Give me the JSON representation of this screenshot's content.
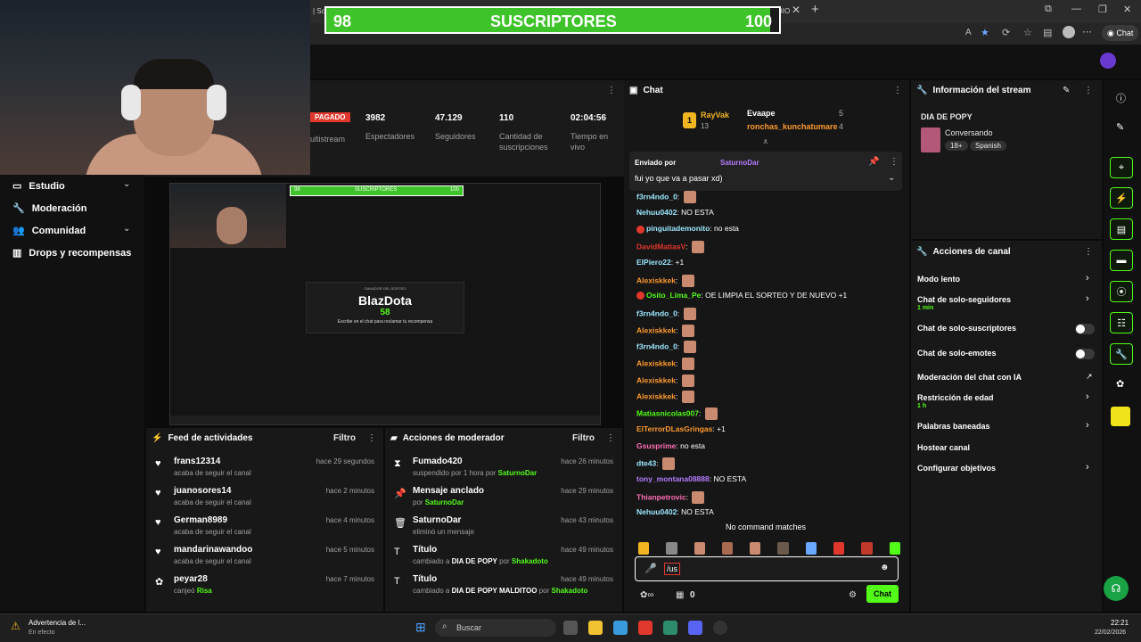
{
  "browser": {
    "tab_fragment": "| Sor",
    "tab_fragment2": "DIO",
    "new_tab": "+",
    "chat_button": "Chat"
  },
  "sub_goal": {
    "current": "98",
    "label": "SUSCRIPTORES",
    "target": "100",
    "progress": 0.98
  },
  "stats": {
    "live_badge": "PAGADO",
    "multistream": "ultistream",
    "viewers": {
      "value": "3982",
      "label": "Espectadores"
    },
    "followers": {
      "value": "47.129",
      "label": "Seguidores"
    },
    "subs": {
      "value": "110",
      "label": "Cantidad de suscripciones"
    },
    "time": {
      "value": "02:04:56",
      "label": "Tiempo en vivo"
    }
  },
  "nav": [
    {
      "label": "Estudio",
      "chevron": "⌄"
    },
    {
      "label": "Moderación"
    },
    {
      "label": "Comunidad",
      "chevron": "⌄"
    },
    {
      "label": "Drops y recompensas"
    }
  ],
  "player": {
    "sub_label": "SUSCRIPTORES",
    "sub_current": "98",
    "sub_target": "100",
    "card_small": "GANADOR DEL SORTEO",
    "winner": "BlazDota",
    "timer": "58",
    "instruction": "Escribe en el chat para reclamar tu recompensa"
  },
  "activity_feed": {
    "title": "Feed de actividades",
    "filter": "Filtro",
    "items": [
      {
        "name": "frans12314",
        "sub": "acaba de seguir el canal",
        "time": "hace 29 segundos"
      },
      {
        "name": "juanosores14",
        "sub": "acaba de seguir el canal",
        "time": "hace 2 minutos"
      },
      {
        "name": "German8989",
        "sub": "acaba de seguir el canal",
        "time": "hace 4 minutos"
      },
      {
        "name": "mandarinawandoo",
        "sub": "acaba de seguir el canal",
        "time": "hace 5 minutos"
      },
      {
        "name": "peyar28",
        "sub": "canjeó",
        "sub_hl": "Risa",
        "time": "hace 7 minutos"
      }
    ]
  },
  "mod_actions": {
    "title": "Acciones de moderador",
    "filter": "Filtro",
    "items": [
      {
        "name": "Fumado420",
        "sub": "suspendido por 1 hora por",
        "sub_hl": "SaturnoDar",
        "time": "hace 26 minutos"
      },
      {
        "name": "Mensaje anclado",
        "sub": "por",
        "sub_hl": "SaturnoDar",
        "time": "hace 29 minutos"
      },
      {
        "name": "SaturnoDar",
        "sub": "eliminó un mensaje",
        "time": "hace 43 minutos"
      },
      {
        "name": "Título",
        "sub": "cambiado a",
        "sub_b": "DIA DE POPY",
        "sub_by": "por",
        "sub_hl": "Shakadoto",
        "time": "hace 49 minutos"
      },
      {
        "name": "Título",
        "sub": "cambiado a",
        "sub_b": "DIA DE POPY MALDITOO",
        "sub_by": "por",
        "sub_hl": "Shakadoto",
        "time": "hace 49 minutos"
      }
    ]
  },
  "chat": {
    "title": "Chat",
    "top": {
      "rank": "1",
      "user1": "RayVak",
      "user1_count": "13",
      "user2": "Evaape",
      "user2_count": "5",
      "user3": "ronchas_kunchatumare",
      "user3_count": "4"
    },
    "pinned": {
      "label": "Enviado por",
      "user": "SaturnoDar",
      "text": "fui yo que va a pasar xd)"
    },
    "messages": [
      {
        "user": "f3rn4ndo_0",
        "color": "#9be7ff",
        "text": "",
        "emote": true
      },
      {
        "user": "Nehuu0402",
        "color": "#9be7ff",
        "text": "NO ESTA"
      },
      {
        "user": "pinguitademonito",
        "color": "#9be7ff",
        "text": "no esta",
        "avatar": true
      },
      {
        "user": "DavidMatiasV",
        "color": "#e2372c",
        "text": "",
        "emote": true
      },
      {
        "user": "ElPiero22",
        "color": "#9be7ff",
        "text": "+1"
      },
      {
        "user": "Alexiskkek",
        "color": "#ff9a2e",
        "text": "",
        "emote": true
      },
      {
        "user": "Osito_Lima_Pe",
        "color": "#53fc18",
        "text": "OE LIMPIA EL SORTEO Y DE NUEVO +1",
        "avatar": true
      },
      {
        "user": "f3rn4ndo_0",
        "color": "#9be7ff",
        "text": "",
        "emote": true
      },
      {
        "user": "Alexiskkek",
        "color": "#ff9a2e",
        "text": "",
        "emote": true
      },
      {
        "user": "f3rn4ndo_0",
        "color": "#9be7ff",
        "text": "",
        "emote": true
      },
      {
        "user": "Alexiskkek",
        "color": "#ff9a2e",
        "text": "",
        "emote": true
      },
      {
        "user": "Alexiskkek",
        "color": "#ff9a2e",
        "text": "",
        "emote": true
      },
      {
        "user": "Alexiskkek",
        "color": "#ff9a2e",
        "text": "",
        "emote": true
      },
      {
        "user": "Matiasnicolas007",
        "color": "#53fc18",
        "text": "",
        "emote": true
      },
      {
        "user": "ElTerrorDLasGringas",
        "color": "#ff9a2e",
        "text": "+1"
      },
      {
        "user": "Gsusprime",
        "color": "#ff6fb5",
        "text": "no esta"
      },
      {
        "user": "dte43",
        "color": "#9be7ff",
        "text": "",
        "emote": true
      },
      {
        "user": "tony_montana08888",
        "color": "#b57bff",
        "text": "NO ESTA"
      },
      {
        "user": "Thianpetrovic",
        "color": "#ff6fb5",
        "text": "",
        "emote": true
      },
      {
        "user": "Nehuu0402",
        "color": "#9be7ff",
        "text": "NO ESTA"
      }
    ],
    "no_command": "No command matches",
    "input_value": "/us",
    "points": "0",
    "send": "Chat"
  },
  "stream_info": {
    "title": "Información del stream",
    "stream_title": "DIA DE POPY",
    "category": "Conversando",
    "tags": [
      "18+",
      "Spanish"
    ]
  },
  "channel_actions": {
    "title": "Acciones de canal",
    "items": [
      {
        "label": "Modo lento",
        "type": "chevron"
      },
      {
        "label": "Chat de solo-seguidores",
        "sub": "1 min",
        "type": "chevron"
      },
      {
        "label": "Chat de solo-suscriptores",
        "type": "toggle"
      },
      {
        "label": "Chat de solo-emotes",
        "type": "toggle"
      },
      {
        "label": "Moderación del chat con IA",
        "type": "external"
      },
      {
        "label": "Restricción de edad",
        "sub": "1 h",
        "type": "chevron"
      },
      {
        "label": "Palabras baneadas",
        "type": "chevron"
      },
      {
        "label": "Hostear canal",
        "type": "none"
      },
      {
        "label": "Configurar objetivos",
        "type": "chevron"
      }
    ]
  },
  "taskbar": {
    "warning_title": "Advertencia de l...",
    "warning_sub": "En efecto",
    "search": "Buscar",
    "time": "22:21",
    "date": "22/02/2026"
  },
  "colors": {
    "accent": "#53fc18",
    "sub_fill": "#3fc32a",
    "badge_red": "#e2372c"
  }
}
